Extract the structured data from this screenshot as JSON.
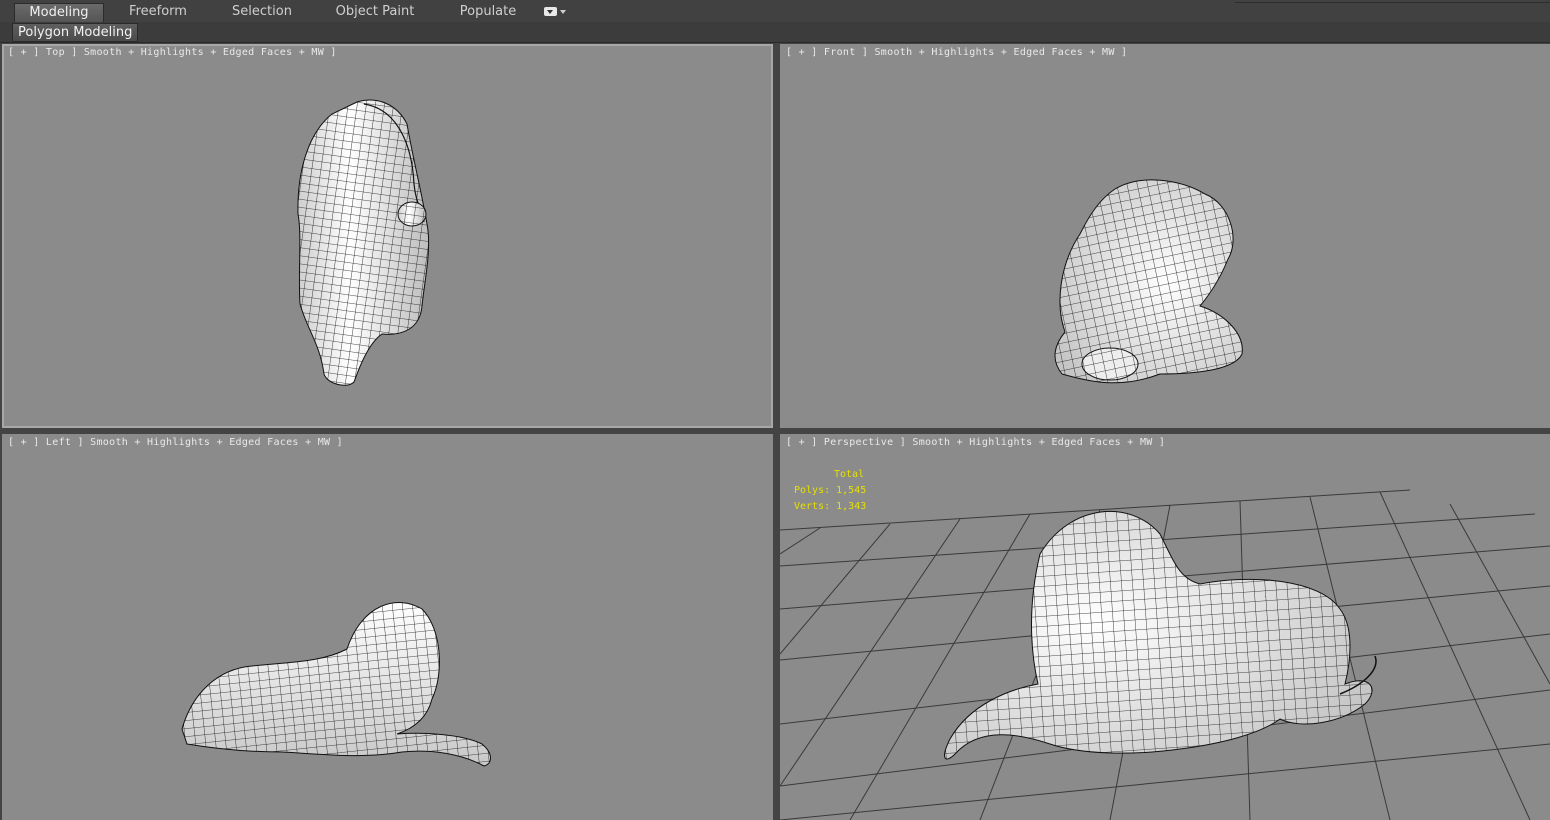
{
  "ribbon": {
    "tabs": [
      {
        "label": "Modeling",
        "active": true
      },
      {
        "label": "Freeform",
        "active": false
      },
      {
        "label": "Selection",
        "active": false
      },
      {
        "label": "Object Paint",
        "active": false
      },
      {
        "label": "Populate",
        "active": false
      }
    ],
    "dropdown_icon": "dropdown-icon"
  },
  "panel": {
    "label": "Polygon Modeling"
  },
  "viewports": {
    "top": {
      "label": "[ + ] Top ] Smooth + Highlights + Edged Faces + MW ]"
    },
    "front": {
      "label": "[ + ] Front ] Smooth + Highlights + Edged Faces + MW ]"
    },
    "left": {
      "label": "[ + ] Left ] Smooth + Highlights + Edged Faces + MW ]"
    },
    "perspective": {
      "label": "[ + ] Perspective ] Smooth + Highlights + Edged Faces + MW ]"
    }
  },
  "statistics": {
    "title": "Total",
    "polys": "Polys: 1,545",
    "verts": "Verts: 1,343"
  },
  "colors": {
    "viewport_bg": "#8b8b8b",
    "ui_bg": "#444444",
    "stats_text": "#e8e000",
    "mesh_fill": "#f2f2f2",
    "mesh_wire": "#111111"
  }
}
